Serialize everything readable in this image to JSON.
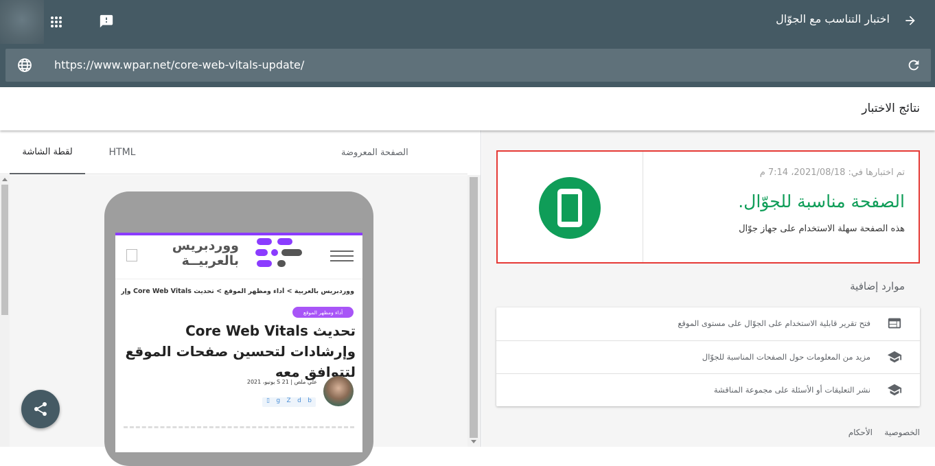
{
  "header": {
    "title": "اختبار التناسب مع الجوّال",
    "url": "https://www.wpar.net/core-web-vitals-update/"
  },
  "results": {
    "title": "نتائج الاختبار"
  },
  "tabs": [
    {
      "label": "الصفحة المعروضة"
    },
    {
      "label": "HTML"
    },
    {
      "label": "لقطة الشاشة"
    }
  ],
  "preview": {
    "logo_text": "ووردبريس بالعربيــة",
    "breadcrumb": "ووردبريس بالعربية > أداء ومظهر الموقع > تحديث Core Web Vitals وإرشادا...",
    "category": "أداء ومظهر الموقع",
    "article_title": "تحديث Core Web Vitals وإرشادات لتحسين صفحات الموقع لتتوافق معه",
    "author_meta": "علي ملص | S 21 يونيو، 2021",
    "social": [
      "b",
      "d",
      "Z",
      "g",
      "▯"
    ]
  },
  "result_card": {
    "tested_on": "تم اختبارها في: 2021/08/18، 7:14 م",
    "headline": "الصفحة مناسبة للجوّال.",
    "description": "هذه الصفحة سهلة الاستخدام على جهاز جوّال"
  },
  "resources": {
    "heading": "موارد إضافية",
    "items": [
      {
        "label": "فتح تقرير قابلية الاستخدام على الجوّال على مستوى الموقع",
        "icon": "web-report-icon"
      },
      {
        "label": "مزيد من المعلومات حول الصفحات المناسبة للجوّال",
        "icon": "school-icon"
      },
      {
        "label": "نشر التعليقات أو الأسئلة على مجموعة المناقشة",
        "icon": "school-icon"
      }
    ]
  },
  "footer": {
    "privacy": "الخصوصية",
    "terms": "الأحكام"
  },
  "colors": {
    "header_bg": "#455a64",
    "urlbar_bg": "#5f717a",
    "success_green": "#0f9d58",
    "highlight_red": "#e53935",
    "brand_purple": "#8b3cff"
  }
}
